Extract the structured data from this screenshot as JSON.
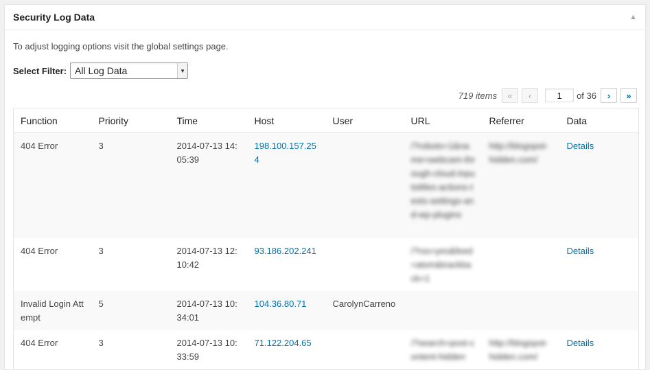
{
  "panel": {
    "title": "Security Log Data",
    "intro": "To adjust logging options visit the global settings page.",
    "filter_label": "Select Filter:",
    "filter_value": "All Log Data"
  },
  "pagination": {
    "count": "719 items",
    "first": "«",
    "prev": "‹",
    "current": "1",
    "of": "of 36",
    "next": "›",
    "last": "»"
  },
  "table": {
    "headers": [
      "Function",
      "Priority",
      "Time",
      "Host",
      "User",
      "URL",
      "Referrer",
      "Data"
    ],
    "rows": [
      {
        "function": "404 Error",
        "priority": "3",
        "time": "2014-07-13 14:05:39",
        "host": "198.100.157.254",
        "user": "",
        "url": "/?robots=1&name=webcam-through-cloud-inputstitles-actions-tests-settings-and-wp-plugins",
        "referrer": "http://blogspot-hidden.com/",
        "data": "Details"
      },
      {
        "function": "404 Error",
        "priority": "3",
        "time": "2014-07-13 12:10:42",
        "host": "93.186.202.241",
        "user": "",
        "url": "/?rss=yes&feed=atom&trackback=1",
        "referrer": "",
        "data": "Details"
      },
      {
        "function": "Invalid Login Attempt",
        "priority": "5",
        "time": "2014-07-13 10:34:01",
        "host": "104.36.80.71",
        "user": "CarolynCarreno",
        "url": "",
        "referrer": "",
        "data": ""
      },
      {
        "function": "404 Error",
        "priority": "3",
        "time": "2014-07-13 10:33:59",
        "host": "71.122.204.65",
        "user": "",
        "url": "/?search=post-content-hidden",
        "referrer": "http://blogspot-hidden.com/",
        "data": "Details"
      }
    ]
  },
  "colors": {
    "link": "#0073aa",
    "row_alt": "#f9f9f9"
  }
}
